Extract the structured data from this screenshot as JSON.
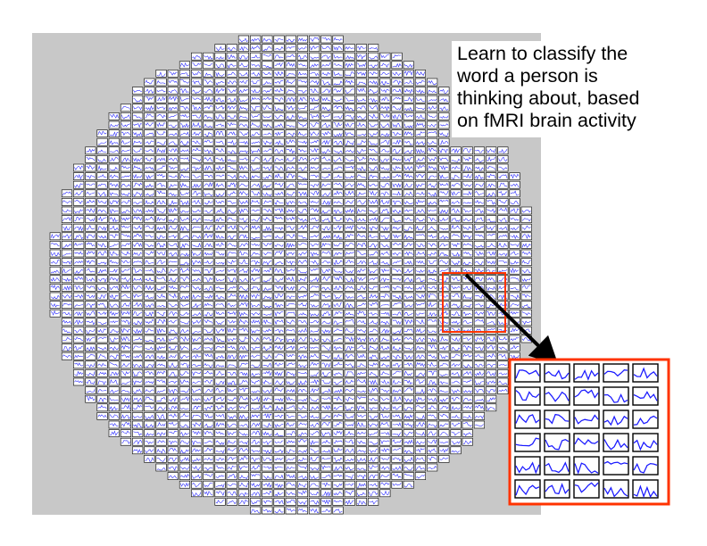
{
  "caption": "Learn to classify the\nword a person is\nthinking about, based\non fMRI brain activity",
  "colors": {
    "panel_background": "#c8c8c8",
    "voxel_border": "#000000",
    "voxel_signal": "#1a1aff",
    "highlight": "#ff3300",
    "arrow": "#000000"
  },
  "icons": {
    "voxel": "voxel-timeseries-icon",
    "arrow": "arrow-icon"
  },
  "zoom_inset": {
    "rows": 6,
    "columns": 5
  }
}
